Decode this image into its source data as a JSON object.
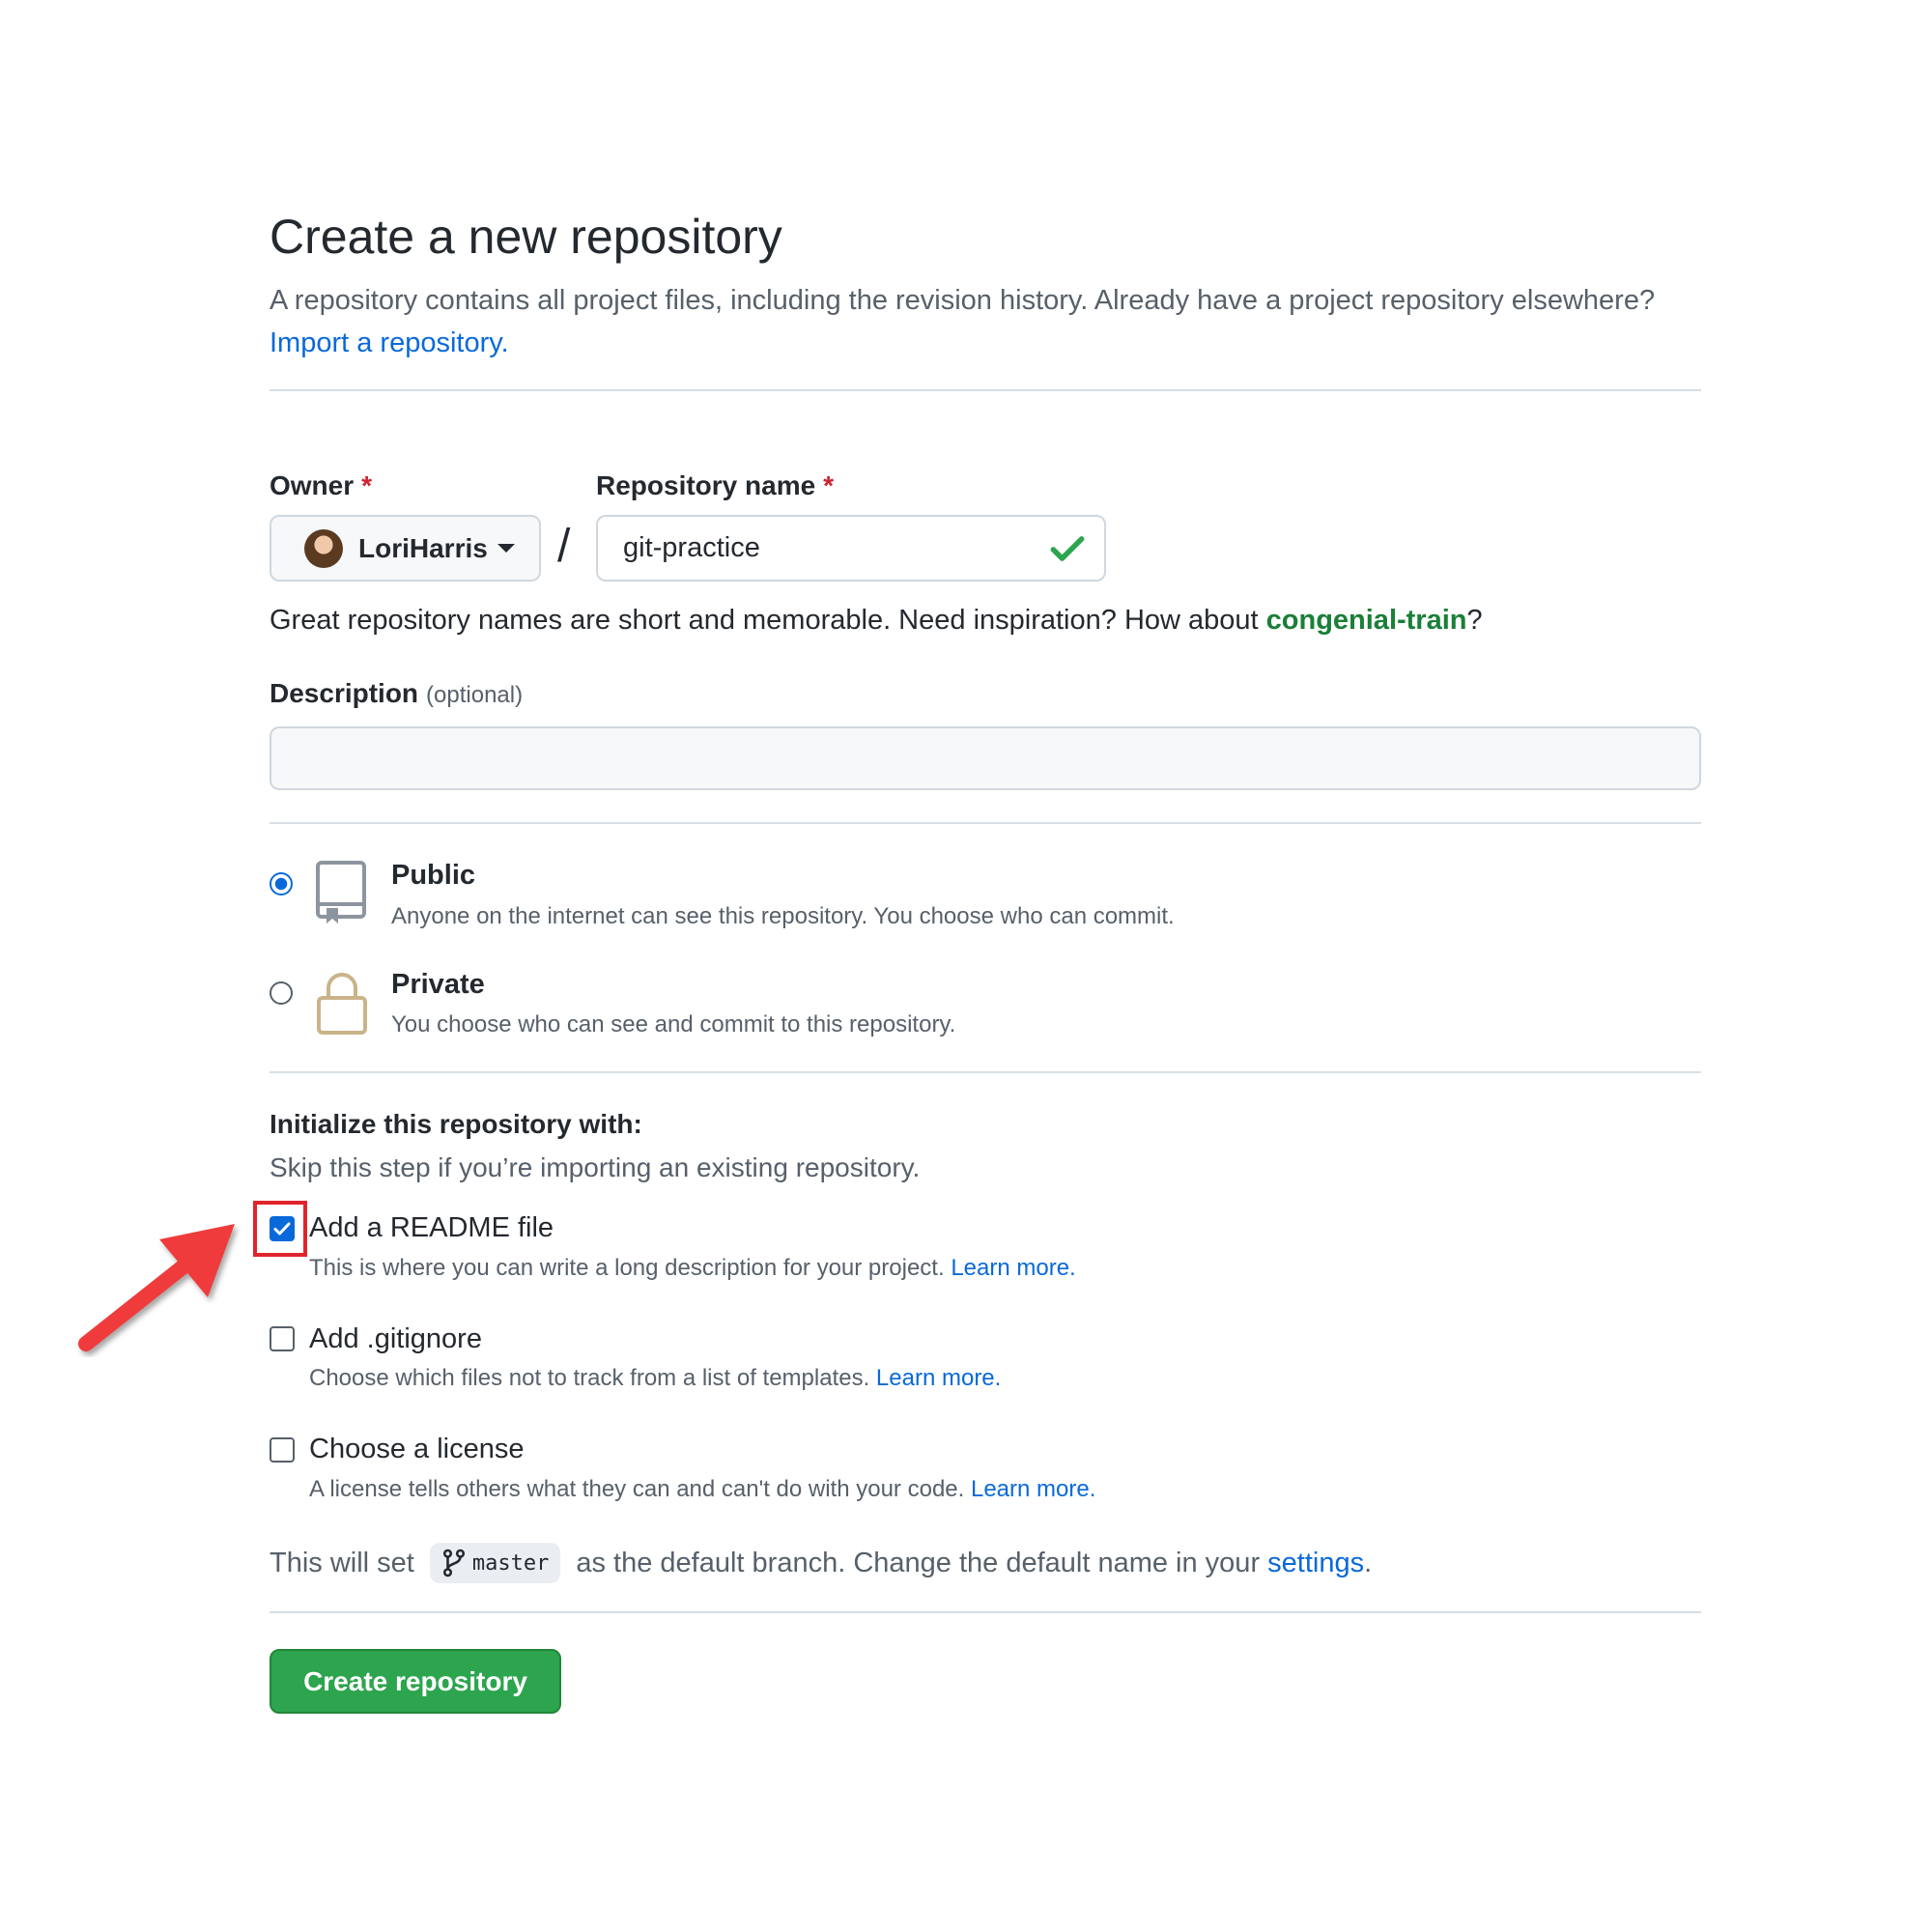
{
  "header": {
    "title": "Create a new repository",
    "subtitle": "A repository contains all project files, including the revision history. Already have a project repository elsewhere?",
    "import_link": "Import a repository."
  },
  "owner": {
    "label": "Owner",
    "required_mark": "*",
    "value": "LoriHarris"
  },
  "slash": "/",
  "repo_name": {
    "label": "Repository name",
    "required_mark": "*",
    "value": "git-practice",
    "valid": true
  },
  "hint": {
    "prefix": "Great repository names are short and memorable. Need inspiration? How about ",
    "suggestion": "congenial-train",
    "suffix": "?"
  },
  "description": {
    "label": "Description",
    "optional": "(optional)",
    "value": ""
  },
  "visibility": {
    "selected": "public",
    "options": [
      {
        "id": "public",
        "title": "Public",
        "desc": "Anyone on the internet can see this repository. You choose who can commit."
      },
      {
        "id": "private",
        "title": "Private",
        "desc": "You choose who can see and commit to this repository."
      }
    ]
  },
  "init": {
    "heading": "Initialize this repository with:",
    "subheading": "Skip this step if you’re importing an existing repository.",
    "options": [
      {
        "title": "Add a README file",
        "desc": "This is where you can write a long description for your project.",
        "link": "Learn more.",
        "checked": true
      },
      {
        "title": "Add .gitignore",
        "desc": "Choose which files not to track from a list of templates.",
        "link": "Learn more.",
        "checked": false
      },
      {
        "title": "Choose a license",
        "desc": "A license tells others what they can and can't do with your code.",
        "link": "Learn more.",
        "checked": false
      }
    ]
  },
  "branch": {
    "prefix": "This will set",
    "name": "master",
    "suffix": "as the default branch. Change the default name in your",
    "settings_link": "settings",
    "end": "."
  },
  "create_button": "Create repository",
  "colors": {
    "primary_green": "#2da44e",
    "link_blue": "#0969da",
    "annotation_red": "#e0242b"
  }
}
